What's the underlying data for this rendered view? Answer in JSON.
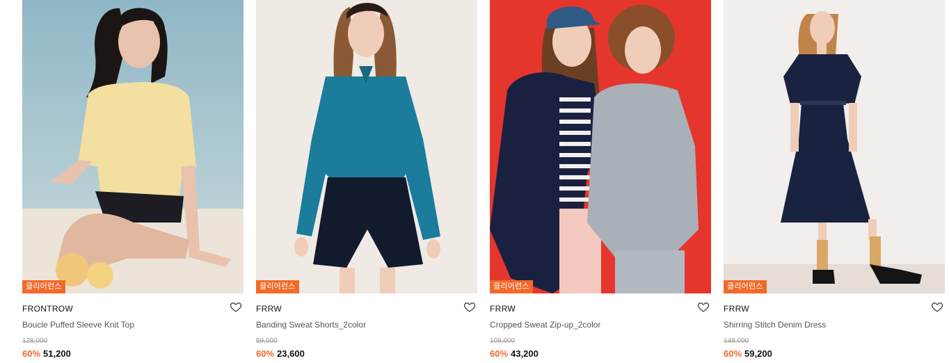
{
  "products": [
    {
      "badge": "클리어런스",
      "brand": "FRONTROW",
      "name": "Boucle Puffed Sleeve Knit Top",
      "original_price": "128,000",
      "discount": "60%",
      "price": "51,200",
      "photo_bg": "#9fc3cf",
      "wishlisted": false
    },
    {
      "badge": "클리어런스",
      "brand": "FRRW",
      "name": "Banding Sweat Shorts_2color",
      "original_price": "59,000",
      "discount": "60%",
      "price": "23,600",
      "photo_bg": "#efeae4",
      "wishlisted": false
    },
    {
      "badge": "클리어런스",
      "brand": "FRRW",
      "name": "Cropped Sweat Zip-up_2color",
      "original_price": "108,000",
      "discount": "60%",
      "price": "43,200",
      "photo_bg": "#e5362e",
      "wishlisted": false
    },
    {
      "badge": "클리어런스",
      "brand": "FRRW",
      "name": "Shirring Stitch Denim Dress",
      "original_price": "148,000",
      "discount": "60%",
      "price": "59,200",
      "photo_bg": "#f1eeec",
      "wishlisted": false
    }
  ],
  "colors": {
    "accent": "#f26a2a",
    "text": "#111111",
    "muted": "#9a9a9a"
  }
}
